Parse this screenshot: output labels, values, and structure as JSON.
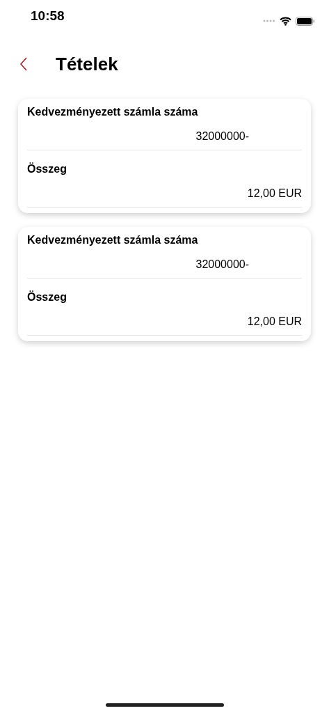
{
  "status_bar": {
    "time": "10:58"
  },
  "nav": {
    "title": "Tételek"
  },
  "cards": [
    {
      "fields": [
        {
          "label": "Kedvezményezett számla száma",
          "value": "32000000-",
          "kind": "account"
        },
        {
          "label": "Összeg",
          "value": "12,00 EUR",
          "kind": "amount"
        }
      ]
    },
    {
      "fields": [
        {
          "label": "Kedvezményezett számla száma",
          "value": "32000000-",
          "kind": "account"
        },
        {
          "label": "Összeg",
          "value": "12,00 EUR",
          "kind": "amount"
        }
      ]
    }
  ]
}
